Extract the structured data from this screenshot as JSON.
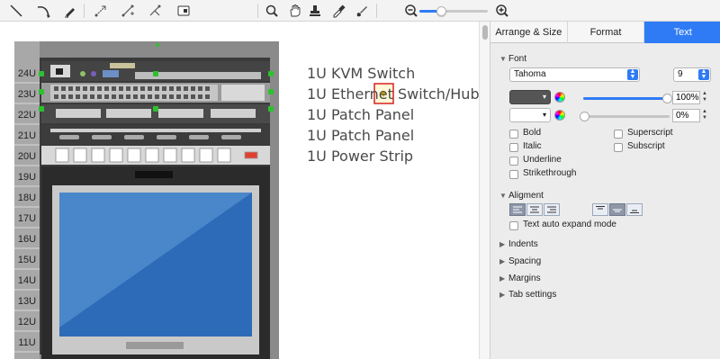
{
  "toolbar": {
    "tools": [
      "line-icon",
      "arc-icon",
      "pen-icon",
      "connector-icon",
      "smart-connector-icon",
      "route-icon",
      "shape-menu-icon"
    ],
    "view_tools": [
      "search-icon",
      "hand-icon",
      "stamp-icon",
      "eyedropper-icon",
      "brush-icon"
    ],
    "zoom_out_icon": "zoom-out-icon",
    "zoom_in_icon": "zoom-in-icon",
    "zoom_level": 0.32,
    "accent": "#2f7bf6"
  },
  "canvas": {
    "rack_units": [
      "24U",
      "23U",
      "22U",
      "21U",
      "20U",
      "19U",
      "18U",
      "17U",
      "16U",
      "15U",
      "14U",
      "13U",
      "12U",
      "11U"
    ],
    "device_labels": [
      "1U KVM Switch",
      "1U Ethernet Switch/Hub",
      "1U Patch Panel",
      "1U Patch Panel",
      "1U Power Strip"
    ],
    "text_color": "#4a4a4a",
    "selection_color": "#2ec12e"
  },
  "panel": {
    "tabs": [
      "Arrange & Size",
      "Format",
      "Text"
    ],
    "active_tab": "Text",
    "font_section": "Font",
    "font_name": "Tahoma",
    "font_size": "9",
    "opacity": "100%",
    "shadow": "0%",
    "style_options": {
      "bold": "Bold",
      "italic": "Italic",
      "underline": "Underline",
      "strikethrough": "Strikethrough",
      "superscript": "Superscript",
      "subscript": "Subscript"
    },
    "alignment_section": "Aligment",
    "auto_expand": "Text auto expand mode",
    "collapsed_sections": [
      "Indents",
      "Spacing",
      "Margins",
      "Tab settings"
    ]
  }
}
